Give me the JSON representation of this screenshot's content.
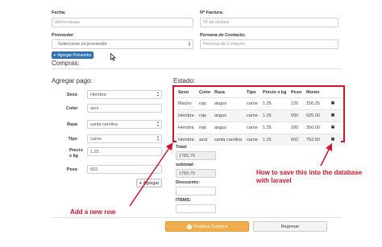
{
  "form": {
    "fecha": {
      "label": "Fecha:",
      "placeholder": "dd/mm/aaaa"
    },
    "factura": {
      "label": "Nº Factura:",
      "placeholder": "Nº de factura"
    },
    "proveedor": {
      "label": "Proveedor",
      "selected": "Seleccione un proveedor"
    },
    "contacto": {
      "label": "Persona de Contacto:",
      "placeholder": "Persona de Contacto"
    },
    "add_provider_button": "Agregar Proveedor"
  },
  "compras_title": "Compras:",
  "agregar_pago": {
    "title": "Agregar pago:",
    "fields": [
      {
        "label": "Sexo",
        "value": "Hembra",
        "type": "select"
      },
      {
        "label": "Color",
        "value": "azul",
        "type": "text"
      },
      {
        "label": "Raza",
        "value": "santa carolina",
        "type": "select"
      },
      {
        "label": "Tipo",
        "value": "carne",
        "type": "select"
      },
      {
        "label": "Precio x kg",
        "value": "1.25",
        "type": "text"
      },
      {
        "label": "Peso",
        "value": "602",
        "type": "text"
      }
    ],
    "add_button": "Agregar"
  },
  "estado": {
    "title": "Estado:",
    "columns": [
      "Sexo",
      "Color",
      "Raza",
      "Tipo",
      "Precio x kg",
      "Peso",
      "Monto"
    ],
    "rows": [
      [
        "Macho",
        "rojo",
        "angus",
        "carne",
        "1.25",
        "125",
        "156.25"
      ],
      [
        "Hembra",
        "rojo",
        "angus",
        "carne",
        "1.25",
        "500",
        "625.00"
      ],
      [
        "Hembra",
        "rojo",
        "angus",
        "carne",
        "1.25",
        "200",
        "250.00"
      ],
      [
        "Hembra",
        "azul",
        "santa carolina",
        "carne",
        "1.25",
        "602",
        "752.50"
      ]
    ],
    "delete_glyph": "✖"
  },
  "totals": {
    "total_label": "Total:",
    "total_value": "1783.75",
    "subtotal_label": "subtotal:",
    "subtotal_value": "1783.75",
    "descuento_label": "Descuento:",
    "itbms_label": "ITBMS:"
  },
  "footer": {
    "finalize_button": "Finalizar Compra",
    "back_button": "Regresar"
  },
  "annotations": {
    "add_row": "Add a new row",
    "save_db": "How to save this into the database\nwith laravel"
  },
  "colors": {
    "primary": "#3277b6",
    "warning": "#f0ad4e",
    "annotation": "#d0142c"
  }
}
